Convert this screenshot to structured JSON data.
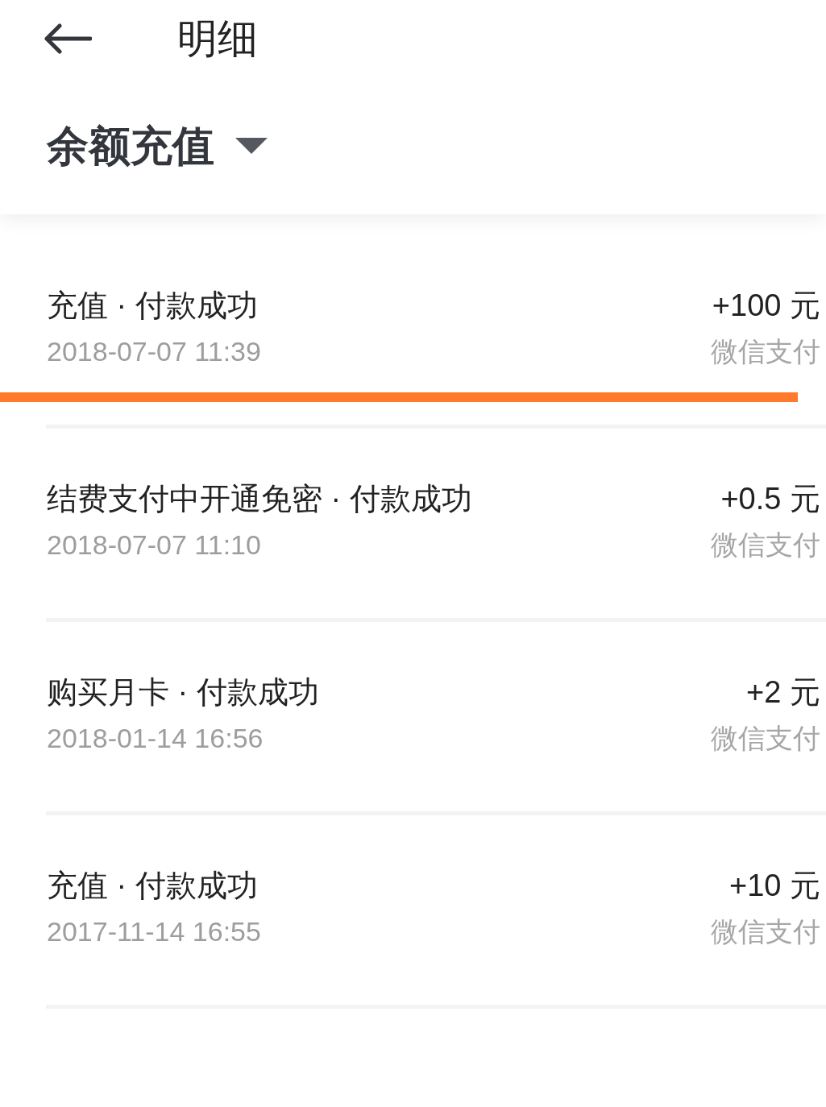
{
  "header": {
    "title": "明细",
    "filter": {
      "label": "余额充值"
    }
  },
  "records": [
    {
      "title": "充值 · 付款成功",
      "time": "2018-07-07 11:39",
      "amount": "+100 元",
      "method": "微信支付",
      "underlined": true
    },
    {
      "title": "结费支付中开通免密 · 付款成功",
      "time": "2018-07-07 11:10",
      "amount": "+0.5 元",
      "method": "微信支付",
      "underlined": false
    },
    {
      "title": "购买月卡 · 付款成功",
      "time": "2018-01-14 16:56",
      "amount": "+2 元",
      "method": "微信支付",
      "underlined": false
    },
    {
      "title": "充值 · 付款成功",
      "time": "2017-11-14 16:55",
      "amount": "+10 元",
      "method": "微信支付",
      "underlined": false
    }
  ]
}
